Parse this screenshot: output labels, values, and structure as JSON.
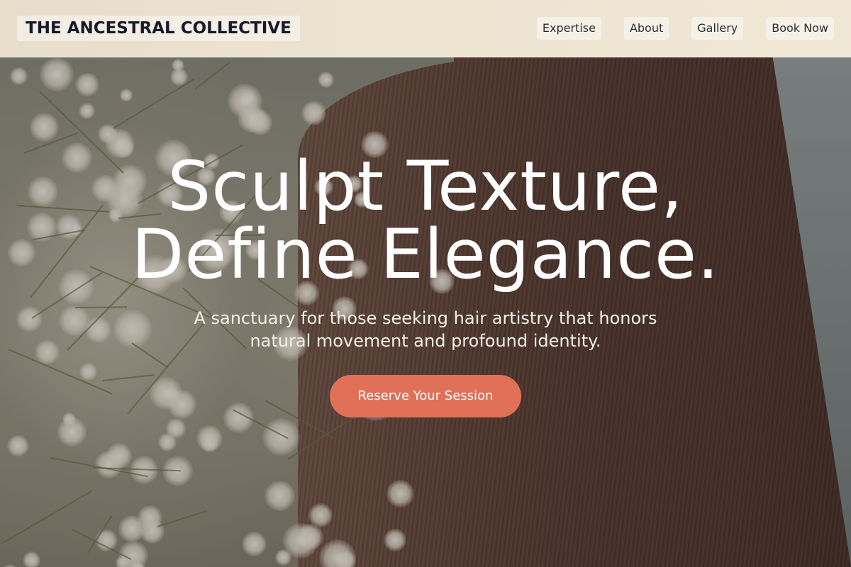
{
  "header": {
    "logo": "THE ANCESTRAL COLLECTIVE",
    "nav": [
      {
        "label": "Expertise"
      },
      {
        "label": "About"
      },
      {
        "label": "Gallery"
      },
      {
        "label": "Book Now"
      }
    ]
  },
  "hero": {
    "headline": [
      "Sculpt Texture,",
      "Define Elegance."
    ],
    "subtitle": [
      "A sanctuary for those seeking hair artistry that honors",
      "natural movement and profound identity."
    ],
    "cta_label": "Reserve Your Session"
  },
  "colors": {
    "cta": "#e07058",
    "logo_text": "#161a2a",
    "header_bg": "#ece2d0",
    "hero_text": "#ffffff"
  }
}
